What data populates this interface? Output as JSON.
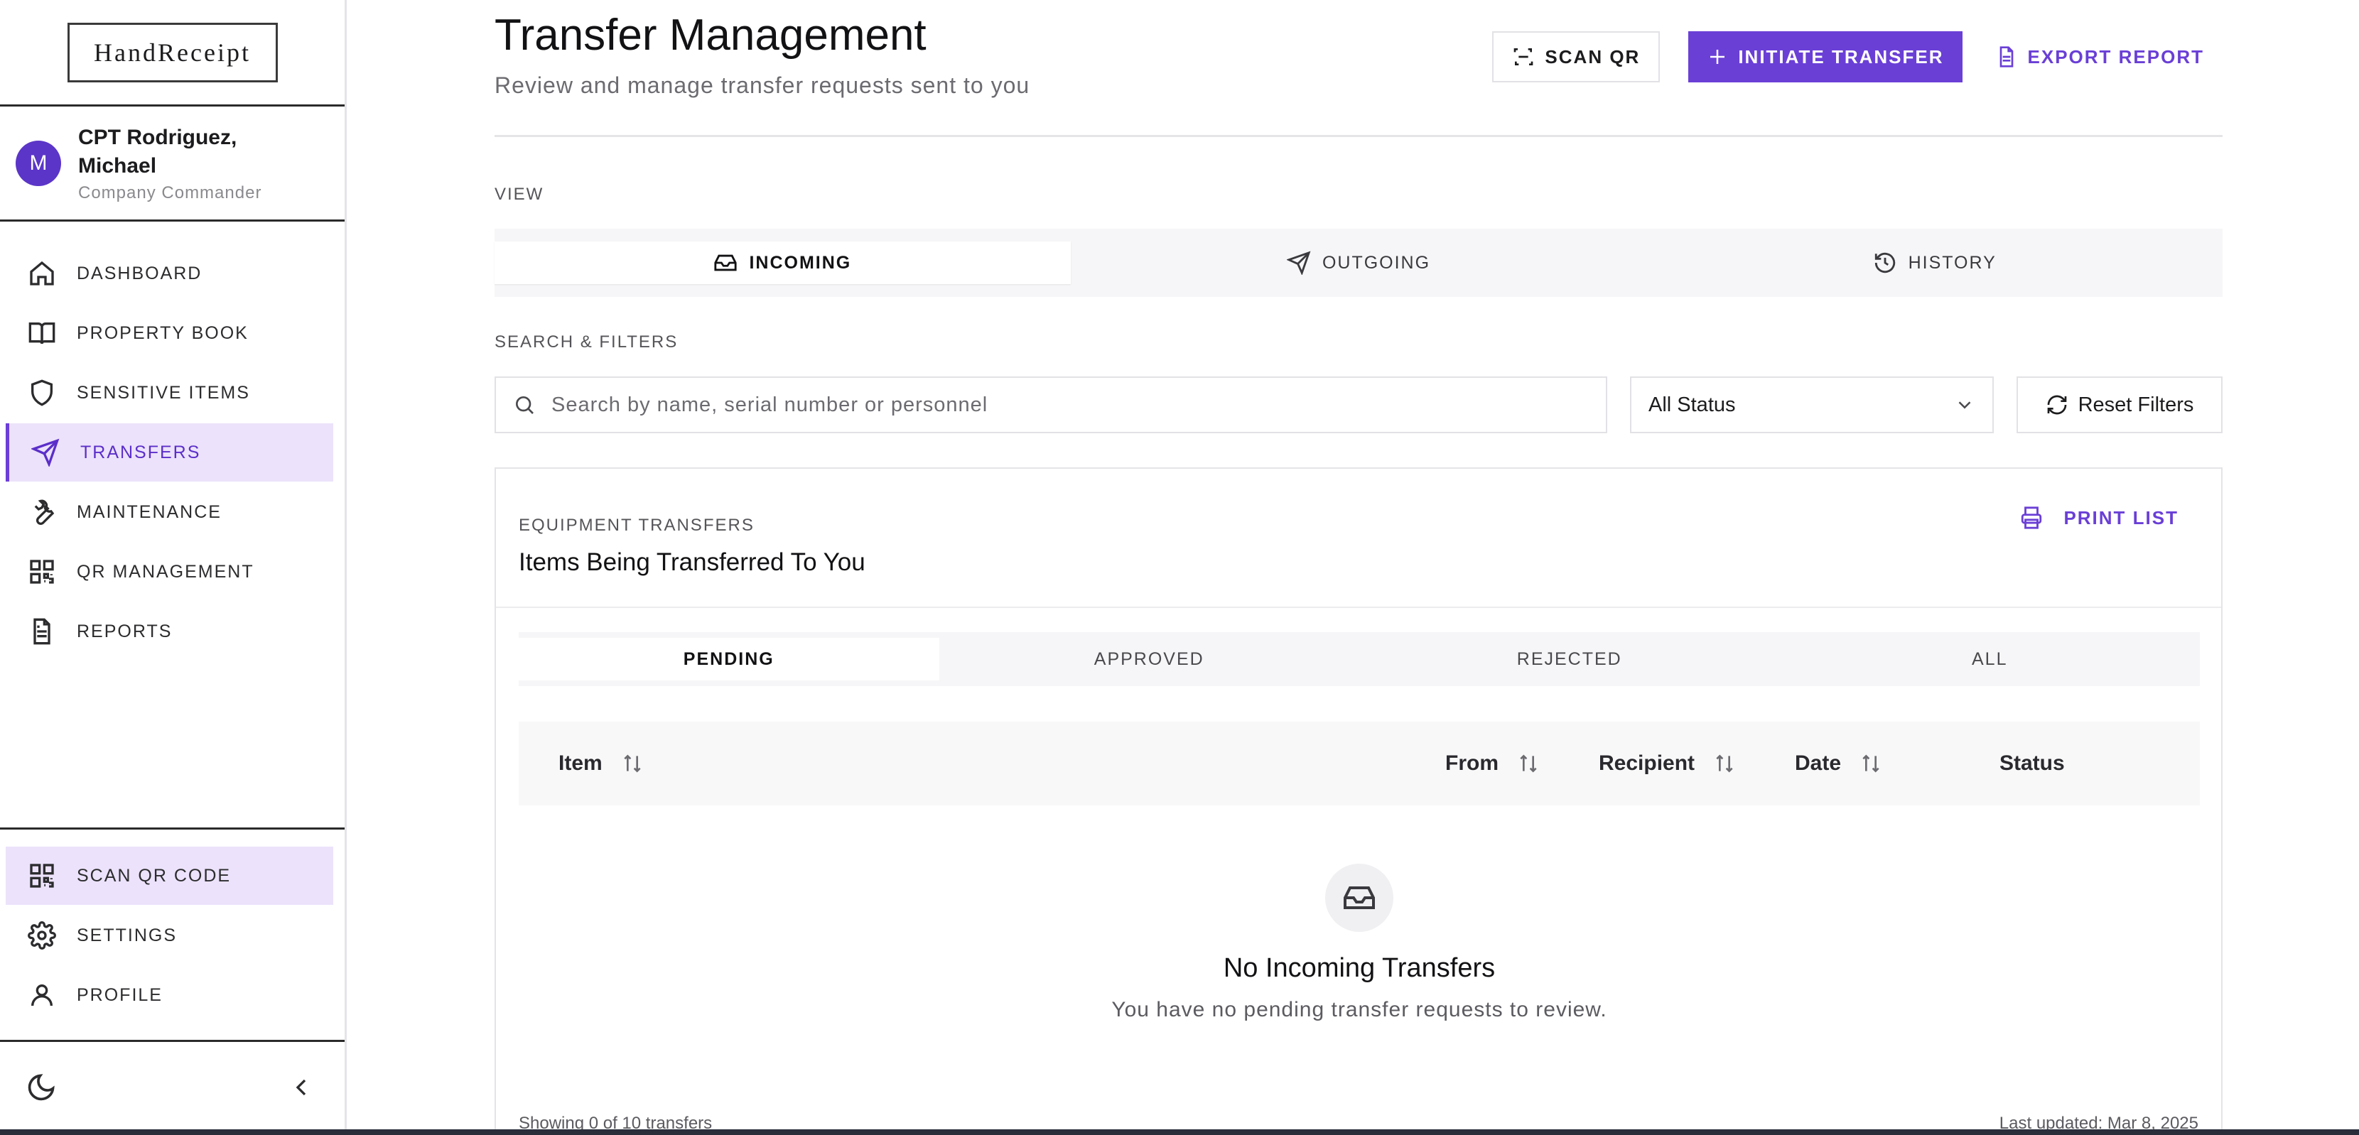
{
  "app": {
    "logo": "HandReceipt"
  },
  "user": {
    "initial": "M",
    "name": "CPT Rodriguez, Michael",
    "role": "Company Commander"
  },
  "sidebar": {
    "items": [
      {
        "label": "DASHBOARD",
        "icon": "home-icon"
      },
      {
        "label": "PROPERTY BOOK",
        "icon": "book-icon"
      },
      {
        "label": "SENSITIVE ITEMS",
        "icon": "shield-icon"
      },
      {
        "label": "TRANSFERS",
        "icon": "send-icon",
        "active": true
      },
      {
        "label": "MAINTENANCE",
        "icon": "wrench-icon"
      },
      {
        "label": "QR MANAGEMENT",
        "icon": "qr-icon"
      },
      {
        "label": "REPORTS",
        "icon": "document-icon"
      }
    ],
    "bottom_items": [
      {
        "label": "SCAN QR CODE",
        "icon": "qr-icon"
      },
      {
        "label": "SETTINGS",
        "icon": "gear-icon"
      },
      {
        "label": "PROFILE",
        "icon": "user-icon"
      }
    ]
  },
  "header": {
    "title": "Transfer Management",
    "subtitle": "Review and manage transfer requests sent to you",
    "scan_qr_label": "SCAN QR",
    "initiate_label": "INITIATE TRANSFER",
    "export_label": "EXPORT REPORT"
  },
  "view": {
    "label": "VIEW",
    "tabs": [
      {
        "label": "INCOMING",
        "icon": "inbox-icon",
        "active": true
      },
      {
        "label": "OUTGOING",
        "icon": "send-icon"
      },
      {
        "label": "HISTORY",
        "icon": "history-icon"
      }
    ]
  },
  "filters": {
    "label": "SEARCH & FILTERS",
    "search_placeholder": "Search by name, serial number or personnel",
    "status_value": "All Status",
    "reset_label": "Reset Filters"
  },
  "card": {
    "eyebrow": "EQUIPMENT TRANSFERS",
    "title": "Items Being Transferred To You",
    "print_label": "PRINT LIST",
    "status_tabs": [
      "PENDING",
      "APPROVED",
      "REJECTED",
      "ALL"
    ],
    "active_status_tab": "PENDING",
    "columns": [
      "Item",
      "From",
      "Recipient",
      "Date",
      "Status"
    ],
    "empty_title": "No Incoming Transfers",
    "empty_subtitle": "You have no pending transfer requests to review.",
    "footer_left": "Showing 0 of 10 transfers",
    "footer_right": "Last updated: Mar 8, 2025"
  },
  "colors": {
    "accent": "#6a3fd6",
    "active_bg": "#ece2fb"
  }
}
